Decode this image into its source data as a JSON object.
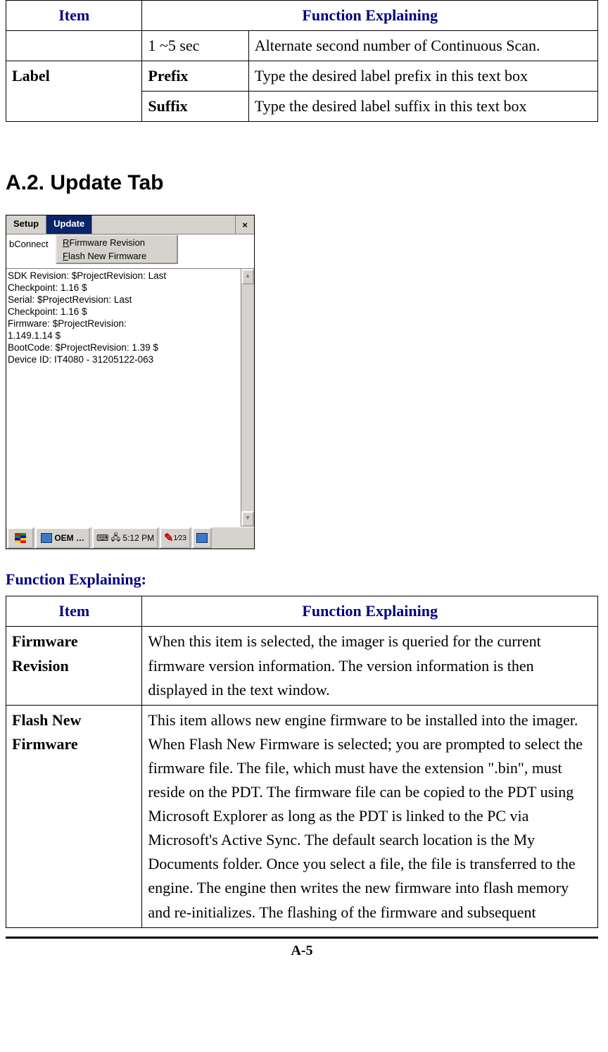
{
  "table1": {
    "headers": {
      "item": "Item",
      "func": "Function Explaining"
    },
    "rows": [
      {
        "item": "",
        "opt": "1 ~5 sec",
        "desc": "Alternate second number of Continuous Scan."
      },
      {
        "item": "Label",
        "opt": "Prefix",
        "desc": "Type the desired label prefix in this text box"
      },
      {
        "item": "",
        "opt": "Suffix",
        "desc": "Type the desired label suffix in this text box"
      }
    ]
  },
  "section_title": "A.2. Update Tab",
  "device": {
    "tabs": {
      "setup": "Setup",
      "update": "Update"
    },
    "close": "×",
    "behind": "bConnect",
    "menu": {
      "rev": "Firmware Revision",
      "flash": "Flash New Firmware"
    },
    "text": "SDK Revision: $ProjectRevision: Last\nCheckpoint: 1.16 $\nSerial: $ProjectRevision: Last\nCheckpoint: 1.16 $\nFirmware: $ProjectRevision:\n1.149.1.14 $\nBootCode: $ProjectRevision: 1.39 $\nDevice ID: IT4080 - 31205122-063",
    "taskbar": {
      "app": "OEM …",
      "time": "5:12 PM",
      "cal": "1⁄23"
    }
  },
  "subheading": "Function Explaining:",
  "table2": {
    "headers": {
      "item": "Item",
      "func": "Function Explaining"
    },
    "rows": [
      {
        "item": "Firmware Revision",
        "desc": "When this item is selected, the imager is queried for the current firmware version information. The version information is then displayed in the text window."
      },
      {
        "item": "Flash New Firmware",
        "desc": "This item allows new engine firmware to be installed into the imager. When Flash New Firmware is selected; you are prompted to select the firmware file. The file, which must have the extension \".bin\", must reside on the PDT. The firmware file can be copied to the PDT using Microsoft Explorer as long as the PDT is linked to the PC via Microsoft's Active Sync. The default search location is the My Documents folder. Once you select a file, the file is transferred to the engine. The engine then writes the new firmware into flash memory and re-initializes. The flashing of the firmware and subsequent"
      }
    ]
  },
  "page_number": "A-5"
}
